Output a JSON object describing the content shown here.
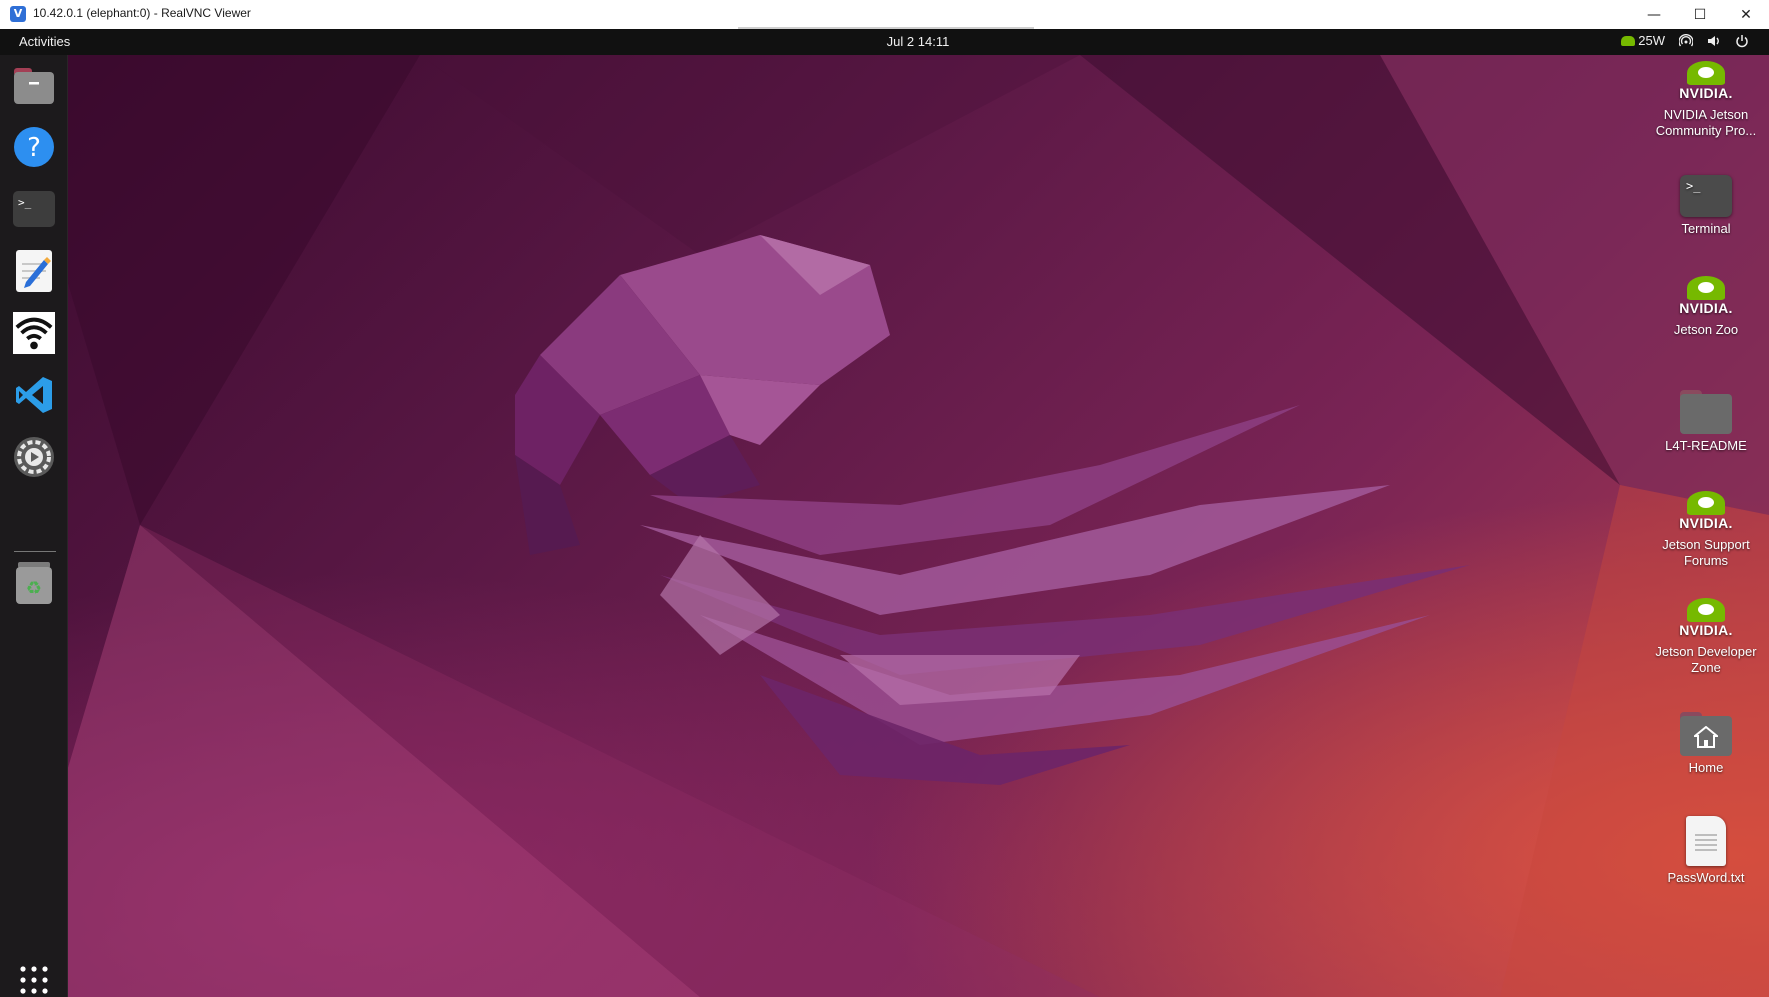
{
  "window": {
    "app_icon": "realvnc-icon",
    "title": "10.42.0.1 (elephant:0) - RealVNC Viewer",
    "controls": {
      "minimize": "—",
      "maximize": "☐",
      "close": "✕"
    }
  },
  "topbar": {
    "activities": "Activities",
    "clock": "Jul 2  14:11",
    "power_mode": "25W",
    "tray_icons": [
      "nvidia-power-icon",
      "wifi-hotspot-icon",
      "volume-icon",
      "power-icon"
    ]
  },
  "dock": {
    "items": [
      {
        "name": "files-icon"
      },
      {
        "name": "help-icon",
        "glyph": "?"
      },
      {
        "name": "terminal-icon",
        "glyph": ">_"
      },
      {
        "name": "text-editor-icon"
      },
      {
        "name": "wifi-icon"
      },
      {
        "name": "vscode-icon"
      },
      {
        "name": "settings-icon"
      },
      {
        "name": "trash-icon",
        "glyph": "♻"
      }
    ],
    "apps_grid": "show-apps-icon"
  },
  "desktop_icons": [
    {
      "label": "NVIDIA Jetson Community Pro...",
      "icon": "nvidia-logo-icon",
      "logo_text": "NVIDIA."
    },
    {
      "label": "Terminal",
      "icon": "terminal-icon",
      "glyph": ">_"
    },
    {
      "label": "Jetson Zoo",
      "icon": "nvidia-logo-icon",
      "logo_text": "NVIDIA."
    },
    {
      "label": "L4T-README",
      "icon": "folder-icon"
    },
    {
      "label": "Jetson Support Forums",
      "icon": "nvidia-logo-icon",
      "logo_text": "NVIDIA."
    },
    {
      "label": "Jetson Developer Zone",
      "icon": "nvidia-logo-icon",
      "logo_text": "NVIDIA."
    },
    {
      "label": "Home",
      "icon": "home-folder-icon"
    },
    {
      "label": "PassWord.txt",
      "icon": "text-file-icon"
    }
  ],
  "colors": {
    "nvidia_green": "#76b900",
    "topbar_bg": "#111111",
    "dock_bg": "#1c1a1c",
    "wallpaper_accent": "#e8583c"
  }
}
